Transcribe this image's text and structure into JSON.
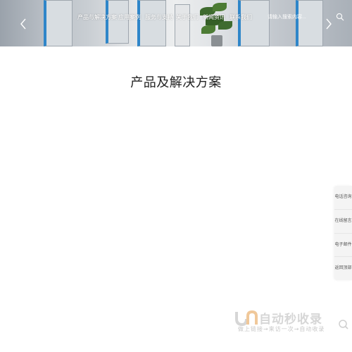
{
  "nav": {
    "items": [
      {
        "label": "产品与解决方案"
      },
      {
        "label": "应用案例"
      },
      {
        "label": "服务与支持"
      },
      {
        "label": "关于我们"
      },
      {
        "label": "新闻资讯"
      },
      {
        "label": "联系我们"
      }
    ]
  },
  "search": {
    "placeholder": "请输入搜索内容..."
  },
  "main": {
    "section_title": "产品及解决方案"
  },
  "side_tools": [
    {
      "label": "电话咨询"
    },
    {
      "label": "在线留言"
    },
    {
      "label": "电子邮件"
    },
    {
      "label": "返回顶部"
    }
  ],
  "watermark": {
    "brand": "自动秒收录",
    "sub": "做上链接→来访一次→自动收录"
  },
  "colors": {
    "accent_blue": "#2f86c9",
    "nav_text": "#ffffff",
    "watermark": "#d6d6d6"
  }
}
